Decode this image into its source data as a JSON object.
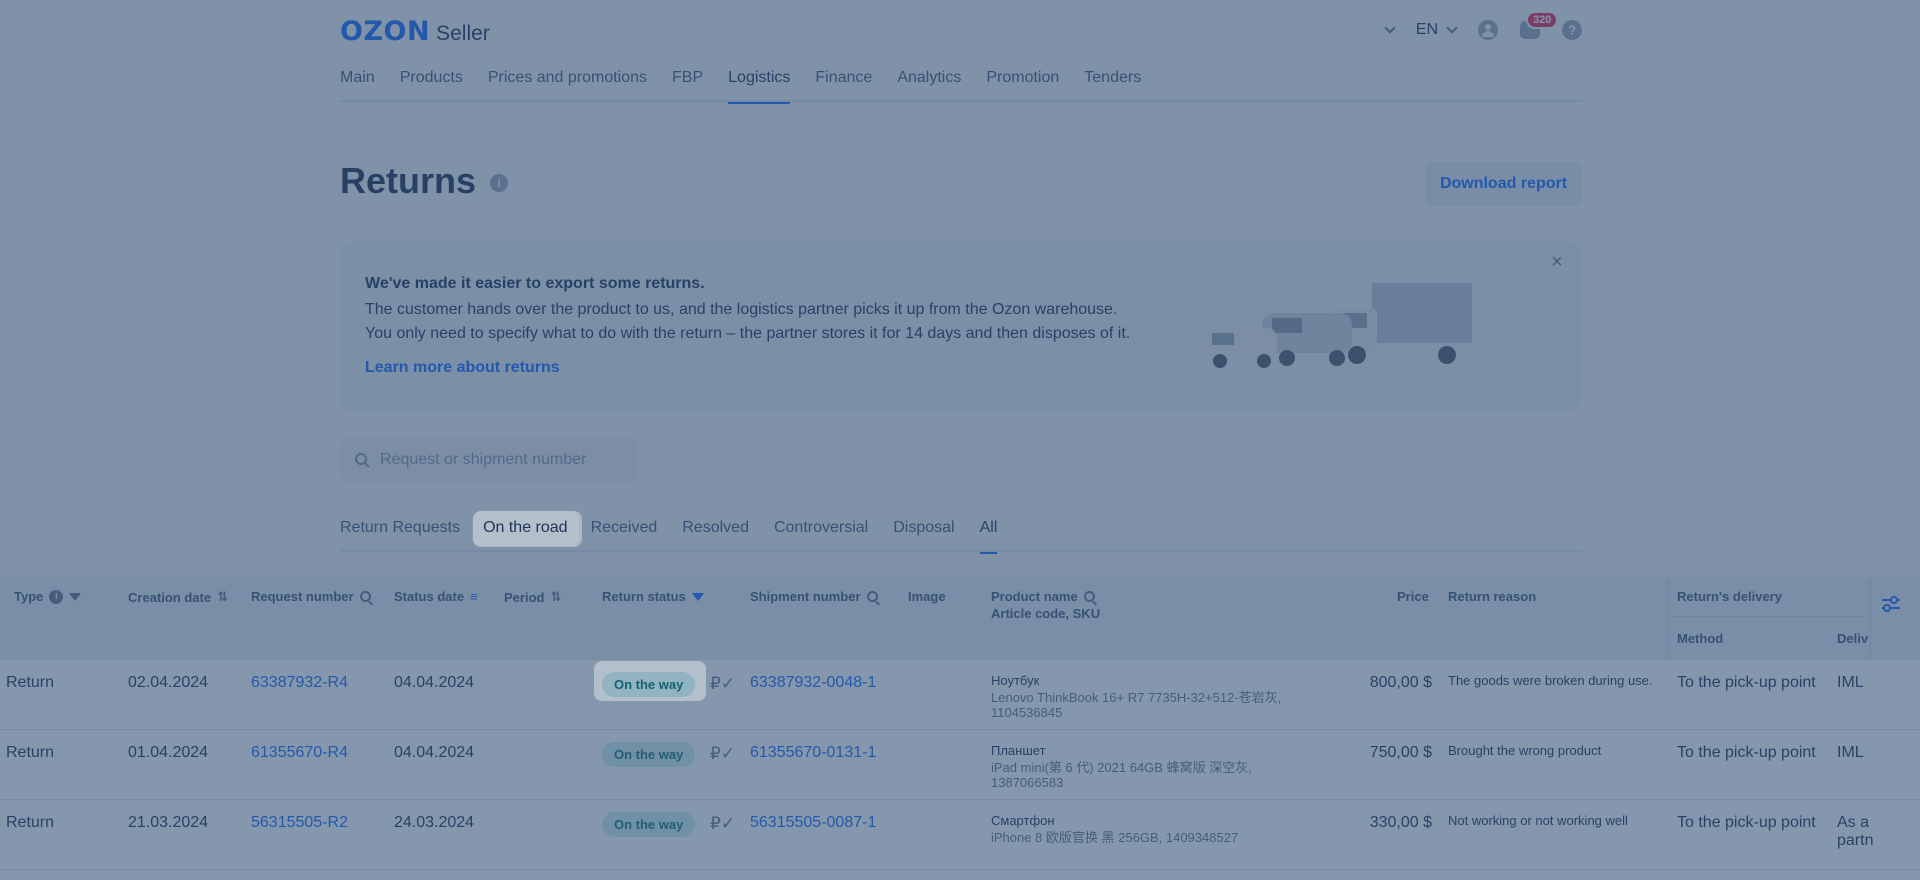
{
  "header": {
    "logo_ozon": "OZON",
    "logo_seller": "Seller",
    "lang": "EN",
    "notifications_count": "320",
    "help": "?"
  },
  "nav": [
    {
      "label": "Main"
    },
    {
      "label": "Products"
    },
    {
      "label": "Prices and promotions"
    },
    {
      "label": "FBP"
    },
    {
      "label": "Logistics",
      "active": true
    },
    {
      "label": "Finance"
    },
    {
      "label": "Analytics"
    },
    {
      "label": "Promotion"
    },
    {
      "label": "Tenders"
    }
  ],
  "page": {
    "title": "Returns",
    "info": "i",
    "download_label": "Download report"
  },
  "banner": {
    "title": "We've made it easier to export some returns.",
    "line1": "The customer hands over the product to us, and the logistics partner picks it up from the Ozon warehouse.",
    "line2": "You only need to specify what to do with the return – the partner stores it for 14 days and then disposes of it.",
    "link": "Learn more about returns",
    "close": "×"
  },
  "search": {
    "placeholder": "Request or shipment number"
  },
  "tabs": [
    {
      "label": "Return Requests"
    },
    {
      "label": "On the road",
      "highlight": true
    },
    {
      "label": "Received"
    },
    {
      "label": "Resolved"
    },
    {
      "label": "Controversial"
    },
    {
      "label": "Disposal"
    },
    {
      "label": "All",
      "active": true
    }
  ],
  "table": {
    "headers": {
      "type": "Type",
      "creation_date": "Creation date",
      "request_number": "Request number",
      "status_date": "Status date",
      "period": "Period",
      "return_status": "Return status",
      "shipment_number": "Shipment number",
      "image": "Image",
      "product_name": "Product name",
      "product_sub": "Article code, SKU",
      "price": "Price",
      "return_reason": "Return reason",
      "delivery": "Return's delivery",
      "method": "Method",
      "delivery_partner": "Deliv"
    },
    "rows": [
      {
        "type": "Return",
        "creation_date": "02.04.2024",
        "request_number": "63387932-R4",
        "status_date": "04.04.2024",
        "status": "On the way",
        "shipment_number": "63387932-0048-1",
        "product_name": "Ноутбук",
        "product_sub": "Lenovo ThinkBook 16+ R7 7735H-32+512-苍岩灰, 1104536845",
        "price": "800,00 $",
        "reason": "The goods were broken during use.",
        "method": "To the pick-up point",
        "partner": "IML"
      },
      {
        "type": "Return",
        "creation_date": "01.04.2024",
        "request_number": "61355670-R4",
        "status_date": "04.04.2024",
        "status": "On the way",
        "shipment_number": "61355670-0131-1",
        "product_name": "Планшет",
        "product_sub": "iPad mini(第 6 代) 2021 64GB 蜂窝版 深空灰, 1387066583",
        "price": "750,00 $",
        "reason": "Brought the wrong product",
        "method": "To the pick-up point",
        "partner": "IML"
      },
      {
        "type": "Return",
        "creation_date": "21.03.2024",
        "request_number": "56315505-R2",
        "status_date": "24.03.2024",
        "status": "On the way",
        "shipment_number": "56315505-0087-1",
        "product_name": "Смартфон",
        "product_sub": "iPhone 8 欧版官换 黑 256GB, 1409348527",
        "price": "330,00 $",
        "reason": "Not working or not working well",
        "method": "To the pick-up point",
        "partner": "As a partn"
      }
    ]
  },
  "colors": {
    "accent": "#005bff",
    "status_bg": "#c9ecee",
    "status_text": "#00696f",
    "badge": "#e4154b"
  }
}
